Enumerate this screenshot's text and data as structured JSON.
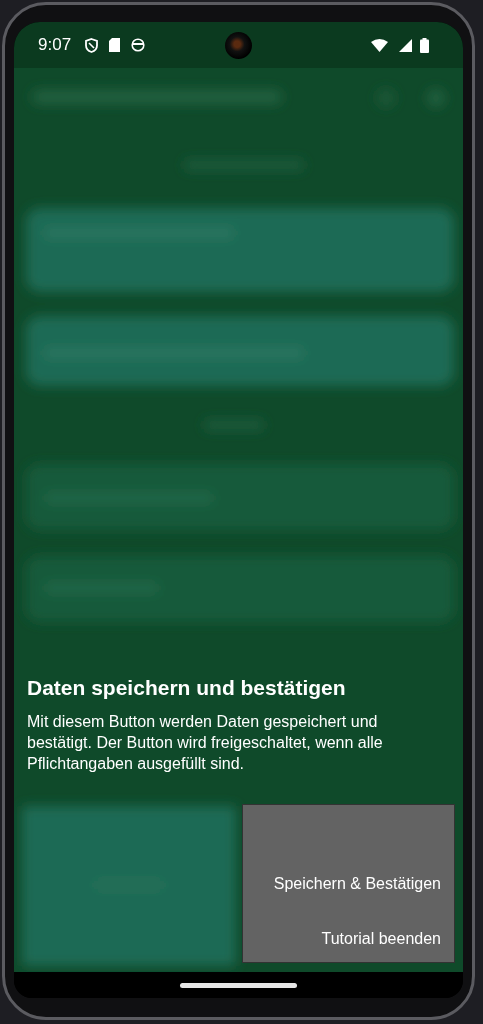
{
  "status_bar": {
    "time": "9:07"
  },
  "tutorial": {
    "title": "Daten speichern und bestätigen",
    "description": "Mit diesem Button werden Daten gespeichert und bestätigt. Der Button wird freigeschaltet, wenn alle Pflichtangaben ausgefüllt sind.",
    "highlighted_button": "Speichern & Bestätigen",
    "end_button": "Tutorial beenden"
  }
}
